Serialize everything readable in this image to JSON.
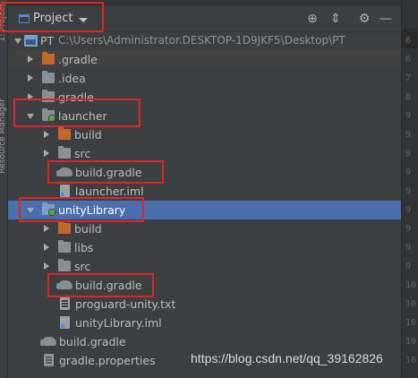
{
  "left_strip": {
    "labels": [
      "1: Project",
      "Resource Manager"
    ]
  },
  "panel": {
    "title": "Project",
    "actions": [
      {
        "icon": "crosshair-icon",
        "glyph": "⊕"
      },
      {
        "icon": "collapse-all-icon",
        "glyph": "⇕"
      },
      {
        "icon": "gear-icon",
        "glyph": "⚙"
      },
      {
        "icon": "minimize-icon",
        "glyph": "—"
      }
    ]
  },
  "tree": {
    "root_name": "PT",
    "root_path": "C:\\Users\\Administrator.DESKTOP-1D9JKF5\\Desktop\\PT",
    "items": [
      {
        "label": ".gradle"
      },
      {
        "label": ".idea"
      },
      {
        "label": "gradle"
      },
      {
        "label": "launcher"
      },
      {
        "label": "build"
      },
      {
        "label": "src"
      },
      {
        "label": "build.gradle"
      },
      {
        "label": "launcher.iml"
      },
      {
        "label": "unityLibrary"
      },
      {
        "label": "build"
      },
      {
        "label": "libs"
      },
      {
        "label": "src"
      },
      {
        "label": "build.gradle"
      },
      {
        "label": "proguard-unity.txt"
      },
      {
        "label": "unityLibrary.iml"
      },
      {
        "label": "build.gradle"
      },
      {
        "label": "gradle.properties"
      }
    ]
  },
  "right_gutter": {
    "line_numbers": [
      "6",
      "6",
      "7",
      "8",
      "9",
      "9",
      "9",
      "9",
      "9",
      "9",
      "9",
      "9",
      "9",
      "10",
      "10",
      "10",
      "10",
      "10",
      "10"
    ]
  },
  "watermark": "https://blog.csdn.net/qq_39162826",
  "colors": {
    "selection": "#4b6eaf",
    "annotation": "#e02424"
  }
}
